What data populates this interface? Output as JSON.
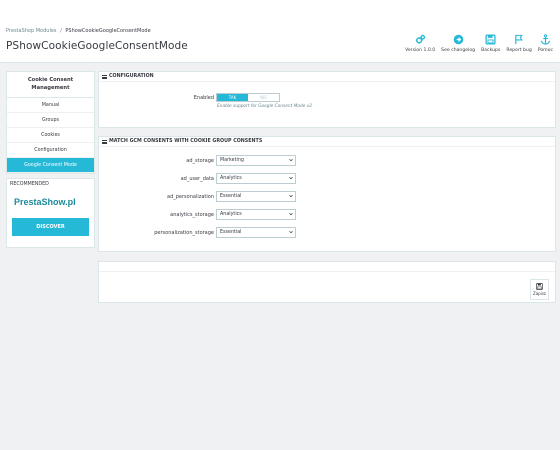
{
  "breadcrumb": {
    "parent": "PrestaShop Modules",
    "separator": "/",
    "current": "PShowCookieGoogleConsentMode"
  },
  "page_title": "PShowCookieGoogleConsentMode",
  "toolbar": {
    "items": [
      {
        "label": "Version 1.0.0",
        "icon": "gears-icon"
      },
      {
        "label": "See changelog",
        "icon": "arrow-circle-icon"
      },
      {
        "label": "Backups",
        "icon": "save-icon"
      },
      {
        "label": "Report bug",
        "icon": "flag-icon"
      },
      {
        "label": "Pomoc",
        "icon": "anchor-icon"
      }
    ]
  },
  "sidebar": {
    "title": "Cookie Consent Management",
    "items": [
      "Manual",
      "Groups",
      "Cookies",
      "Configuration",
      "Google Consent Mode"
    ],
    "active_index": 4
  },
  "recommended": {
    "title": "RECOMMENDED",
    "logo_text": "PrestaShow.pl",
    "button_label": "DISCOVER"
  },
  "configuration": {
    "heading": "CONFIGURATION",
    "enabled_label": "Enabled",
    "toggle_on": "TAK",
    "toggle_off": "NIE",
    "help_text": "Enable support for Google Consent Mode v2"
  },
  "match": {
    "heading": "MATCH GCM CONSENTS WITH COOKIE GROUP CONSENTS",
    "rows": [
      {
        "label": "ad_storage",
        "value": "Marketing"
      },
      {
        "label": "ad_user_data",
        "value": "Analytics"
      },
      {
        "label": "ad_personalization",
        "value": "Essential"
      },
      {
        "label": "analytics_storage",
        "value": "Analytics"
      },
      {
        "label": "personalization_storage",
        "value": "Essential"
      }
    ]
  },
  "footer": {
    "save_label": "Zapisz"
  },
  "colors": {
    "accent": "#25b9d7",
    "text": "#363a41",
    "background": "#eff1f2"
  }
}
